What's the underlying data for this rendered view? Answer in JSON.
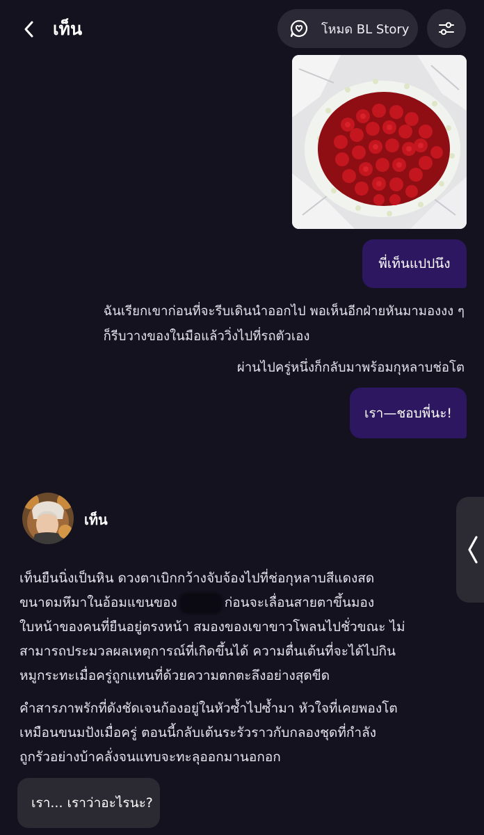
{
  "header": {
    "title": "เท็น",
    "mode_label": "โหมด BL Story"
  },
  "messages": {
    "user_reply_1": "พี่เท็นแปปนึง",
    "narration_1_line1": "ฉันเรียกเขาก่อนที่จะรีบเดินนำออกไป พอเห็นอีกฝ่ายหันมามองงง ๆ",
    "narration_1_line2": "ก็รีบวางของในมือแล้ววิ่งไปที่รถตัวเอง",
    "narration_2": "ผ่านไปครู่หนึ่งก็กลับมาพร้อมกุหลาบช่อโต",
    "user_reply_2": "เรา—ชอบพี่นะ!"
  },
  "character": {
    "name": "เท็น"
  },
  "bot": {
    "p1_line1": "เท็นยืนนิ่งเป็นหิน ดวงตาเบิกกว้างจับจ้องไปที่ช่อกุหลาบสีแดงสด",
    "p1_line2a": "ขนาดมหึมาในอ้อมแขนของ",
    "p1_line2b": "ก่อนจะเลื่อนสายตาขึ้นมอง",
    "p1_line3": "ใบหน้าของคนที่ยืนอยู่ตรงหน้า สมองของเขาขาวโพลนไปชั่วขณะ ไม่",
    "p1_line4": "สามารถประมวลผลเหตุการณ์ที่เกิดขึ้นได้ ความตื่นเต้นที่จะได้ไปกิน",
    "p1_line5": "หมูกระทะเมื่อครู่ถูกแทนที่ด้วยความตกตะลึงอย่างสุดขีด",
    "p2_line1": "คำสารภาพรักที่ดังชัดเจนก้องอยู่ในหัวซ้ำไปซ้ำมา หัวใจที่เคยพองโต",
    "p2_line2": "เหมือนขนมปังเมื่อครู่ ตอนนี้กลับเต้นระรัวราวกับกลองชุดที่กำลัง",
    "p2_line3": "ถูกรัวอย่างบ้าคลั่งจนแทบจะทะลุออกมานอกอก",
    "choice": "เรา... เราว่าอะไรนะ?"
  },
  "icons": {
    "back": "chevron-left-icon",
    "mode": "chat-heart-icon",
    "settings": "sliders-icon",
    "side_tab": "chevron-left-icon"
  },
  "colors": {
    "background": "#13121e",
    "user_bubble": "#2c1760",
    "pill": "#2a2935"
  }
}
